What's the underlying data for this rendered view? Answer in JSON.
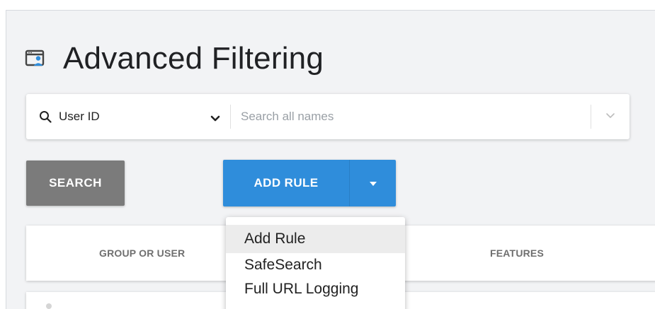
{
  "page": {
    "title": "Advanced Filtering",
    "title_icon": "user-window-icon"
  },
  "search": {
    "field_value": "User ID",
    "placeholder": "Search all names",
    "icon": "search-icon"
  },
  "buttons": {
    "search_label": "SEARCH",
    "add_rule_label": "ADD RULE",
    "colors": {
      "search_bg": "#7b7b7b",
      "add_rule_bg": "#2f8ddb"
    }
  },
  "dropdown": {
    "items": [
      {
        "label": "Add Rule",
        "highlighted": true
      },
      {
        "label": "SafeSearch",
        "highlighted": false
      },
      {
        "label": "Full URL Logging",
        "highlighted": false
      }
    ]
  },
  "table": {
    "columns": [
      "GROUP OR USER",
      "FEATURES"
    ]
  }
}
